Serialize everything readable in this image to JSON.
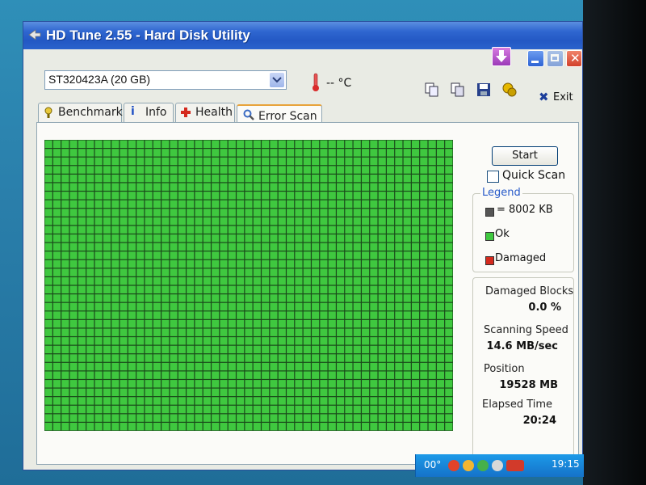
{
  "window": {
    "title": "HD Tune 2.55 - Hard Disk Utility"
  },
  "toolbar": {
    "drive": "ST320423A (20 GB)",
    "temperature": "-- °C",
    "exit_label": "Exit"
  },
  "tabs": [
    {
      "label": "Benchmark",
      "icon": "benchmark-icon"
    },
    {
      "label": "Info",
      "icon": "info-icon"
    },
    {
      "label": "Health",
      "icon": "health-icon"
    },
    {
      "label": "Error Scan",
      "icon": "error-scan-icon",
      "active": true
    }
  ],
  "scan": {
    "columns": 49,
    "rows": 34,
    "ok_color": "#3fc83f",
    "grid_line_color": "#1a4a1a"
  },
  "controls": {
    "start_label": "Start",
    "quick_scan_label": "Quick Scan",
    "quick_scan_checked": false
  },
  "legend": {
    "title": "Legend",
    "items": [
      {
        "label": "= 8002 KB",
        "color": "#555555"
      },
      {
        "label": "Ok",
        "color": "#3fc83f"
      },
      {
        "label": "Damaged",
        "color": "#d42a1e"
      }
    ]
  },
  "stats": {
    "damaged_blocks_label": "Damaged Blocks",
    "damaged_blocks_value": "0.0 %",
    "scanning_speed_label": "Scanning Speed",
    "scanning_speed_value": "14.6 MB/sec",
    "position_label": "Position",
    "position_value": "19528 MB",
    "elapsed_time_label": "Elapsed Time",
    "elapsed_time_value": "20:24"
  },
  "taskbar": {
    "tray_temp": "00°",
    "clock": "19:15"
  }
}
